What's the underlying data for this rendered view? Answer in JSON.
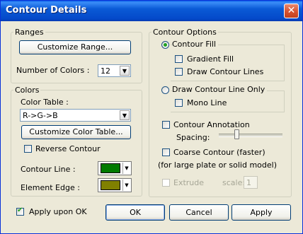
{
  "window": {
    "title": "Contour Details",
    "close_label": "✕"
  },
  "ranges": {
    "legend": "Ranges",
    "customize_button": "Customize Range...",
    "num_colors_label": "Number of Colors :",
    "num_colors_value": "12"
  },
  "colors": {
    "legend": "Colors",
    "table_label": "Color Table :",
    "table_value": "R->G->B",
    "customize_button": "Customize Color Table...",
    "reverse_label": "Reverse Contour",
    "contour_line_label": "Contour Line :",
    "contour_line_color": "#007a00",
    "element_edge_label": "Element Edge :",
    "element_edge_color": "#808000"
  },
  "options": {
    "legend": "Contour Options",
    "contour_fill": "Contour Fill",
    "gradient_fill": "Gradient Fill",
    "draw_contour_lines": "Draw Contour Lines",
    "draw_line_only": "Draw Contour Line Only",
    "mono_line": "Mono Line",
    "annotation": "Contour Annotation",
    "spacing": "Spacing:",
    "coarse": "Coarse Contour (faster)",
    "coarse_note": "(for large plate or solid model)",
    "extrude": "Extrude",
    "scale_label": "scale:",
    "scale_value": "1"
  },
  "footer": {
    "apply_upon_ok": "Apply upon OK",
    "ok": "OK",
    "cancel": "Cancel",
    "apply": "Apply"
  },
  "colors_accent": {
    "titlebar": "#0a5ad6",
    "check": "#21a121"
  }
}
